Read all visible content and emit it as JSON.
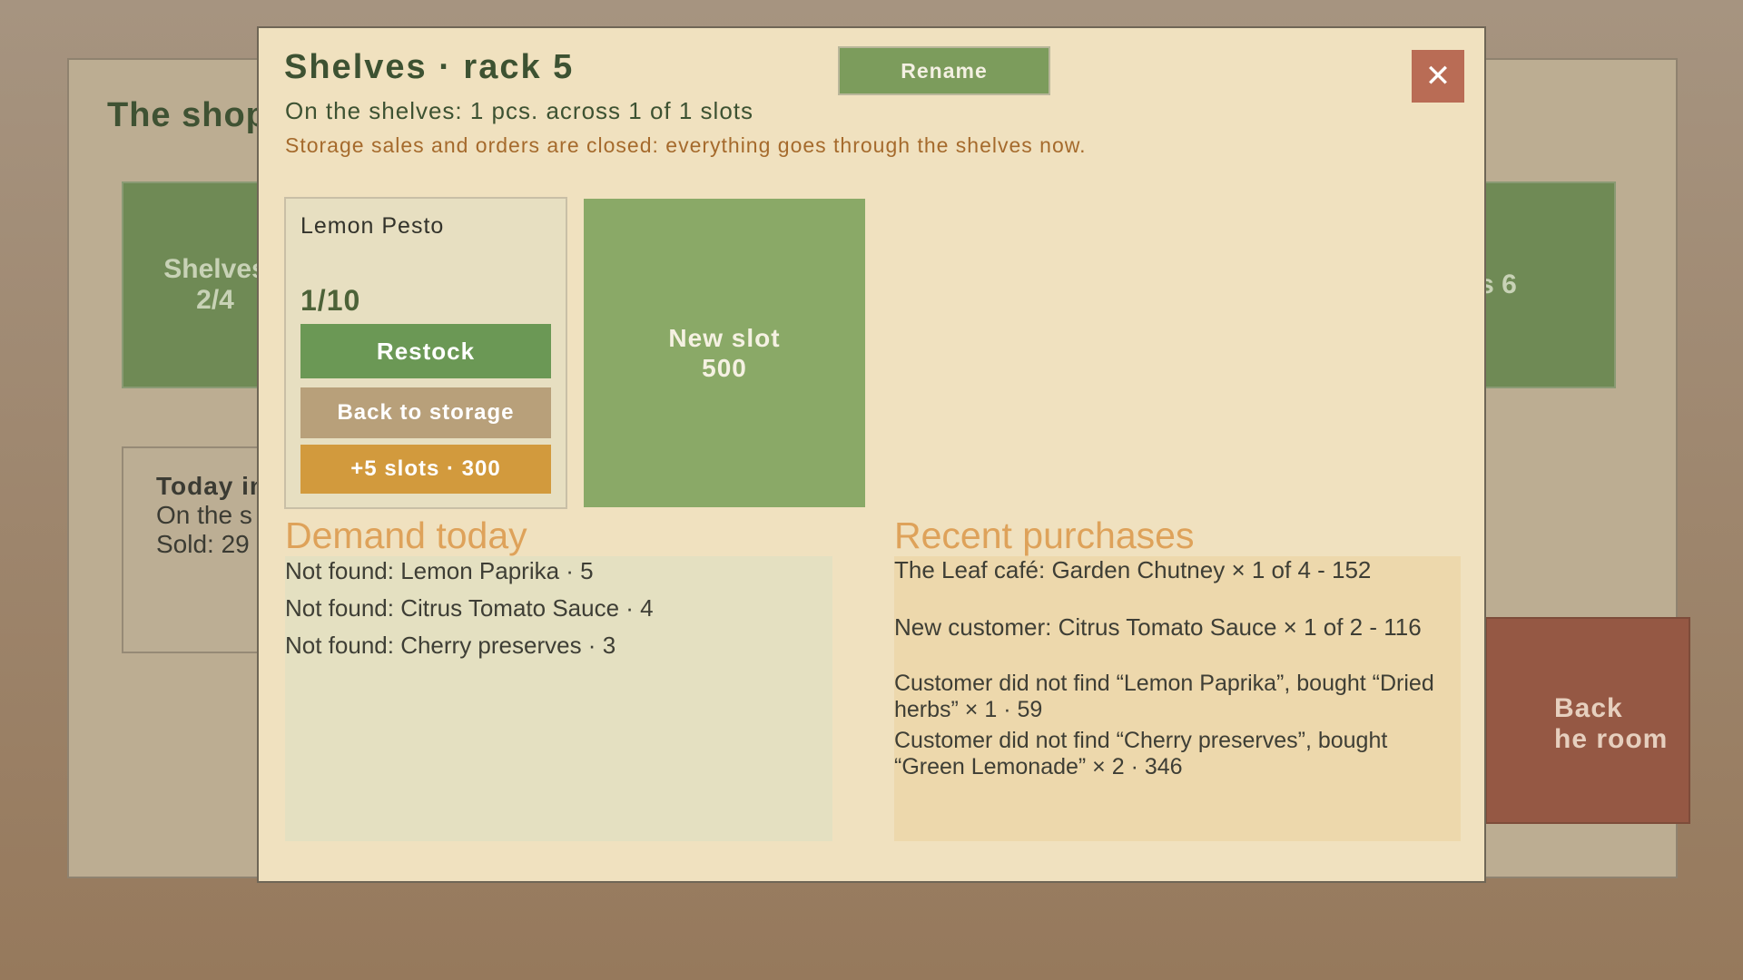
{
  "background": {
    "shop_title": "The shop",
    "left_tile": {
      "line1": "Shelves",
      "line2": "2/4"
    },
    "right_tile": {
      "label": "s 6"
    },
    "today": {
      "heading": "Today in",
      "line1": "On the s",
      "line2": "Sold: 29"
    },
    "back_room": {
      "line1": "Back",
      "line2": "he room"
    }
  },
  "modal": {
    "title": "Shelves · rack 5",
    "rename_label": "Rename",
    "close_label": "✕",
    "summary": "On the shelves: 1 pcs. across 1 of 1 slots",
    "notice": "Storage sales and orders are closed: everything goes through the shelves now.",
    "slot": {
      "name": "Lemon Pesto",
      "count": "1/10",
      "restock_label": "Restock",
      "back_to_storage_label": "Back to storage",
      "plus_slots_label": "+5 slots · 300"
    },
    "new_slot": {
      "line1": "New slot",
      "line2": "500"
    },
    "demand": {
      "title": "Demand today",
      "items": [
        "Not found: Lemon Paprika · 5",
        "Not found: Citrus Tomato Sauce · 4",
        "Not found: Cherry preserves · 3"
      ]
    },
    "purchases": {
      "title": "Recent purchases",
      "items": [
        "The Leaf café: Garden Chutney × 1 of 4 - 152",
        "New customer: Citrus Tomato Sauce × 1 of 2 - 116",
        "Customer did not find “Lemon Paprika”, bought “Dried herbs” × 1 · 59",
        "Customer did not find “Cherry preserves”, bought “Green Lemonade” × 2 · 346"
      ]
    }
  },
  "colors": {
    "modal_bg": "#f0e1bf",
    "primary_green": "#6b9855",
    "accent_orange": "#d29a3d",
    "close_red": "#b96c55"
  }
}
